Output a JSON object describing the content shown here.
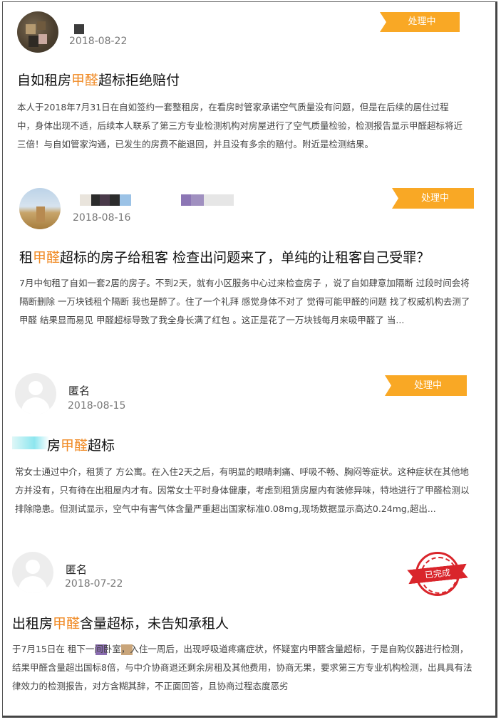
{
  "posts": [
    {
      "username": "",
      "date": "2018-08-22",
      "status": "处理中",
      "title_before": "自如租房",
      "title_highlight": "甲醛",
      "title_after": "超标拒绝赔付",
      "body": "本人于2018年7月31日在自如签约一套整租房，在看房时管家承诺空气质量没有问题，但是在后续的居住过程中，身体出现不适，后续本人联系了第三方专业检测机构对房屋进行了空气质量检验，检测报告显示甲醛超标将近三倍！与自如管家沟通，已发生的房费不能退回，并且没有多余的赔付。附近是检测结果。"
    },
    {
      "username": "",
      "date": "2018-08-16",
      "status": "处理中",
      "title_before": "租",
      "title_highlight": "甲醛",
      "title_after": "超标的房子给租客 检查出问题来了，单纯的让租客自己受罪？",
      "body": "7月中旬租了自如一套2居的房子。不到2天，就有小区服务中心过来检查房子 ，说了自如肆意加隔断 过段时间会将隔断删除 一万块钱租个隔断 我也是醉了。住了一个礼拜 感觉身体不对了 觉得可能甲醛的问题 找了权威机构去测了甲醛 结果显而易见 甲醛超标导致了我全身长满了红包 。这正是花了一万块钱每月来吸甲醛了 当..."
    },
    {
      "username": "匿名",
      "date": "2018-08-15",
      "status": "处理中",
      "title_before": "房",
      "title_highlight": "甲醛",
      "title_after": "超标",
      "body": "常女士通过中介，租赁了 方公寓。在入住2天之后，有明显的眼睛刺痛、呼吸不畅、胸闷等症状。这种症状在其他地方并没有，只有待在出租屋内才有。因常女士平时身体健康，考虑到租赁房屋内有装修异味，特地进行了甲醛检测以排除隐患。但测试显示，空气中有害气体含量严重超出国家标准0.08mg,现场数据显示高达0.24mg,超出..."
    },
    {
      "username": "匿名",
      "date": "2018-07-22",
      "status": "已完成",
      "title_before": "出租房",
      "title_highlight": "甲醛",
      "title_after": "含量超标，未告知承租人",
      "body": "于7月15日在 租下一间卧室，入住一周后，出现呼吸道疼痛症状，怀疑室内甲醛含量超标，于是自购仪器进行检测，结果甲醛含量超出国标8倍，与中介协商退还剩余房租及其他费用，协商无果，要求第三方专业机构检测，出具具有法律效力的检测报告，对方含糊其辞，不正面回答，且协商过程态度恶劣"
    }
  ],
  "colors": {
    "status_processing": "#f9a825",
    "status_done": "#d9252b",
    "highlight": "#f08a24"
  }
}
